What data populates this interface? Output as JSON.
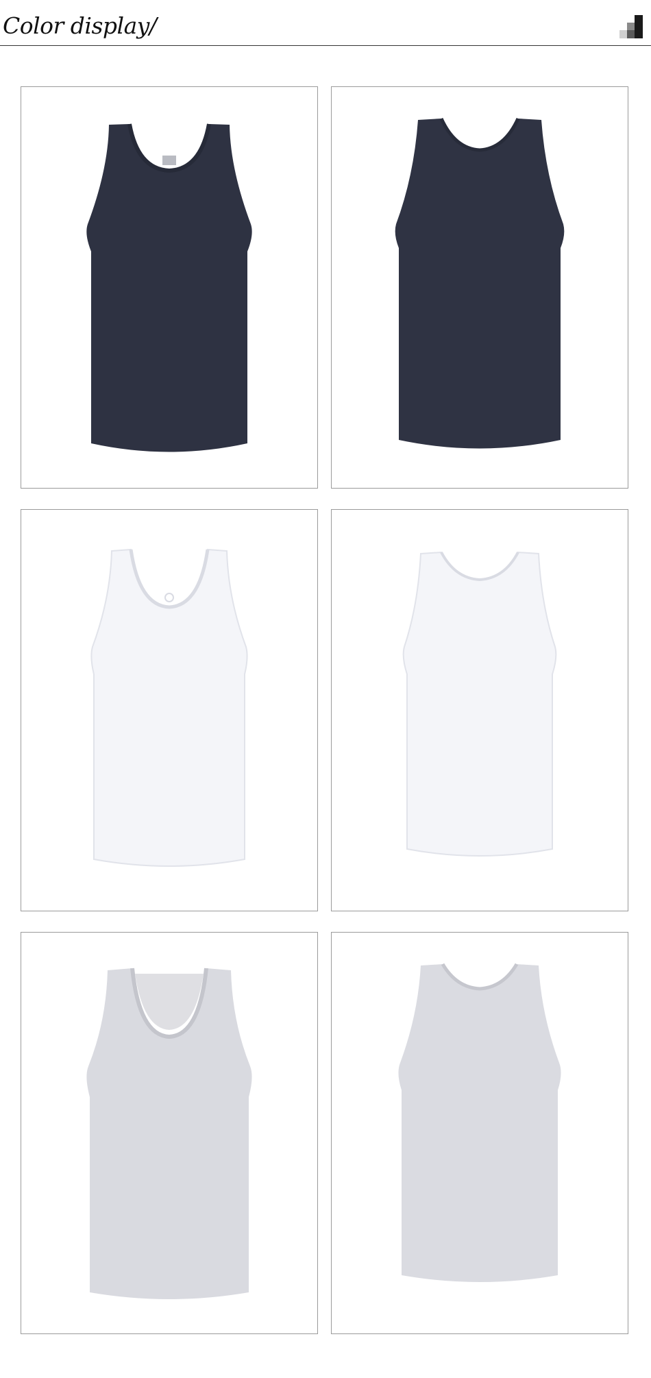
{
  "header": {
    "title": "Color display/",
    "logo_icon": "pixel-mosaic-icon"
  },
  "colors": {
    "navy": "#2e3242",
    "white": "#f4f5f9",
    "heather_grey": "#d9dae0",
    "panel_border": "#9a9a9a",
    "rule": "#333333"
  },
  "gallery": [
    {
      "name": "navy-tank-front",
      "color": "navy",
      "view": "front"
    },
    {
      "name": "navy-tank-back",
      "color": "navy",
      "view": "back"
    },
    {
      "name": "white-tank-front",
      "color": "white",
      "view": "front"
    },
    {
      "name": "white-tank-back",
      "color": "white",
      "view": "back"
    },
    {
      "name": "grey-tank-front",
      "color": "heather_grey",
      "view": "front"
    },
    {
      "name": "grey-tank-back",
      "color": "heather_grey",
      "view": "back"
    }
  ]
}
